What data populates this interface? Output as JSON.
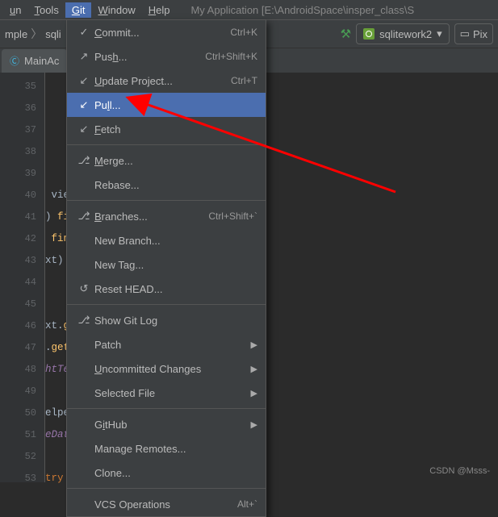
{
  "menubar": {
    "items": [
      {
        "label_pre": "",
        "mnemonic": "u",
        "label_post": "n"
      },
      {
        "label_pre": "",
        "mnemonic": "T",
        "label_post": "ools"
      },
      {
        "label_pre": "",
        "mnemonic": "G",
        "label_post": "it"
      },
      {
        "label_pre": "",
        "mnemonic": "W",
        "label_post": "indow"
      },
      {
        "label_pre": "",
        "mnemonic": "H",
        "label_post": "elp"
      }
    ],
    "title": "My Application [E:\\AndroidSpace\\insper_class\\S"
  },
  "toolbar": {
    "crumb1": "mple",
    "crumb2": "sqli",
    "hammer": "⚒",
    "config_name": "sqlitework2",
    "pixel_label": "Pix"
  },
  "tab": {
    "filename": "MainAc"
  },
  "gutter_start": 35,
  "gutter_count": 19,
  "code_lines": [
    "",
    "",
    "",
    "",
    "",
    " view){",
    ") findViewById(R.id.name);",
    " findViewById(R.id.age);",
    "xt) findViewById(R.id.height);",
    "",
    "",
    "xt.getText().toString();",
    ".getText().toString();",
    "htText.getText().toString();",
    "",
    "elper = new MyOpenHelper( context:",
    "eDatabase = null;",
    "",
    "try {"
  ],
  "menu": {
    "items": [
      {
        "icon": "✓",
        "pre": "",
        "m": "C",
        "post": "ommit...",
        "shortcut": "Ctrl+K",
        "sub": false
      },
      {
        "icon": "↗",
        "pre": "Pus",
        "m": "h",
        "post": "...",
        "shortcut": "Ctrl+Shift+K",
        "sub": false
      },
      {
        "icon": "↙",
        "pre": "",
        "m": "U",
        "post": "pdate Project...",
        "shortcut": "Ctrl+T",
        "sub": false
      },
      {
        "icon": "↙",
        "pre": "Pu",
        "m": "l",
        "post": "l...",
        "shortcut": "",
        "sub": false,
        "highlight": true
      },
      {
        "icon": "↙",
        "pre": "",
        "m": "F",
        "post": "etch",
        "shortcut": "",
        "sub": false
      },
      {
        "sep": true
      },
      {
        "icon": "⎇",
        "pre": "",
        "m": "M",
        "post": "erge...",
        "shortcut": "",
        "sub": false
      },
      {
        "icon": "",
        "pre": "Rebase...",
        "m": "",
        "post": "",
        "shortcut": "",
        "sub": false
      },
      {
        "sep": true
      },
      {
        "icon": "⎇",
        "pre": "",
        "m": "B",
        "post": "ranches...",
        "shortcut": "Ctrl+Shift+`",
        "sub": false
      },
      {
        "icon": "",
        "pre": "New Branch...",
        "m": "",
        "post": "",
        "shortcut": "",
        "sub": false
      },
      {
        "icon": "",
        "pre": "New Tag...",
        "m": "",
        "post": "",
        "shortcut": "",
        "sub": false
      },
      {
        "icon": "↺",
        "pre": "Reset HEAD...",
        "m": "",
        "post": "",
        "shortcut": "",
        "sub": false
      },
      {
        "sep": true
      },
      {
        "icon": "⎇",
        "pre": "Show Git Log",
        "m": "",
        "post": "",
        "shortcut": "",
        "sub": false
      },
      {
        "icon": "",
        "pre": "Patch",
        "m": "",
        "post": "",
        "shortcut": "",
        "sub": true
      },
      {
        "icon": "",
        "pre": "",
        "m": "U",
        "post": "ncommitted Changes",
        "shortcut": "",
        "sub": true
      },
      {
        "icon": "",
        "pre": "Selected File",
        "m": "",
        "post": "",
        "shortcut": "",
        "sub": true
      },
      {
        "sep": true
      },
      {
        "icon": "",
        "pre": "G",
        "m": "i",
        "post": "tHub",
        "shortcut": "",
        "sub": true
      },
      {
        "icon": "",
        "pre": "Manage Remotes...",
        "m": "",
        "post": "",
        "shortcut": "",
        "sub": false
      },
      {
        "icon": "",
        "pre": "Clone...",
        "m": "",
        "post": "",
        "shortcut": "",
        "sub": false
      },
      {
        "sep": true
      },
      {
        "icon": "",
        "pre": "VCS Operations",
        "m": "",
        "post": "",
        "shortcut": "Alt+`",
        "sub": false
      }
    ]
  },
  "watermark": "CSDN @Msss-"
}
